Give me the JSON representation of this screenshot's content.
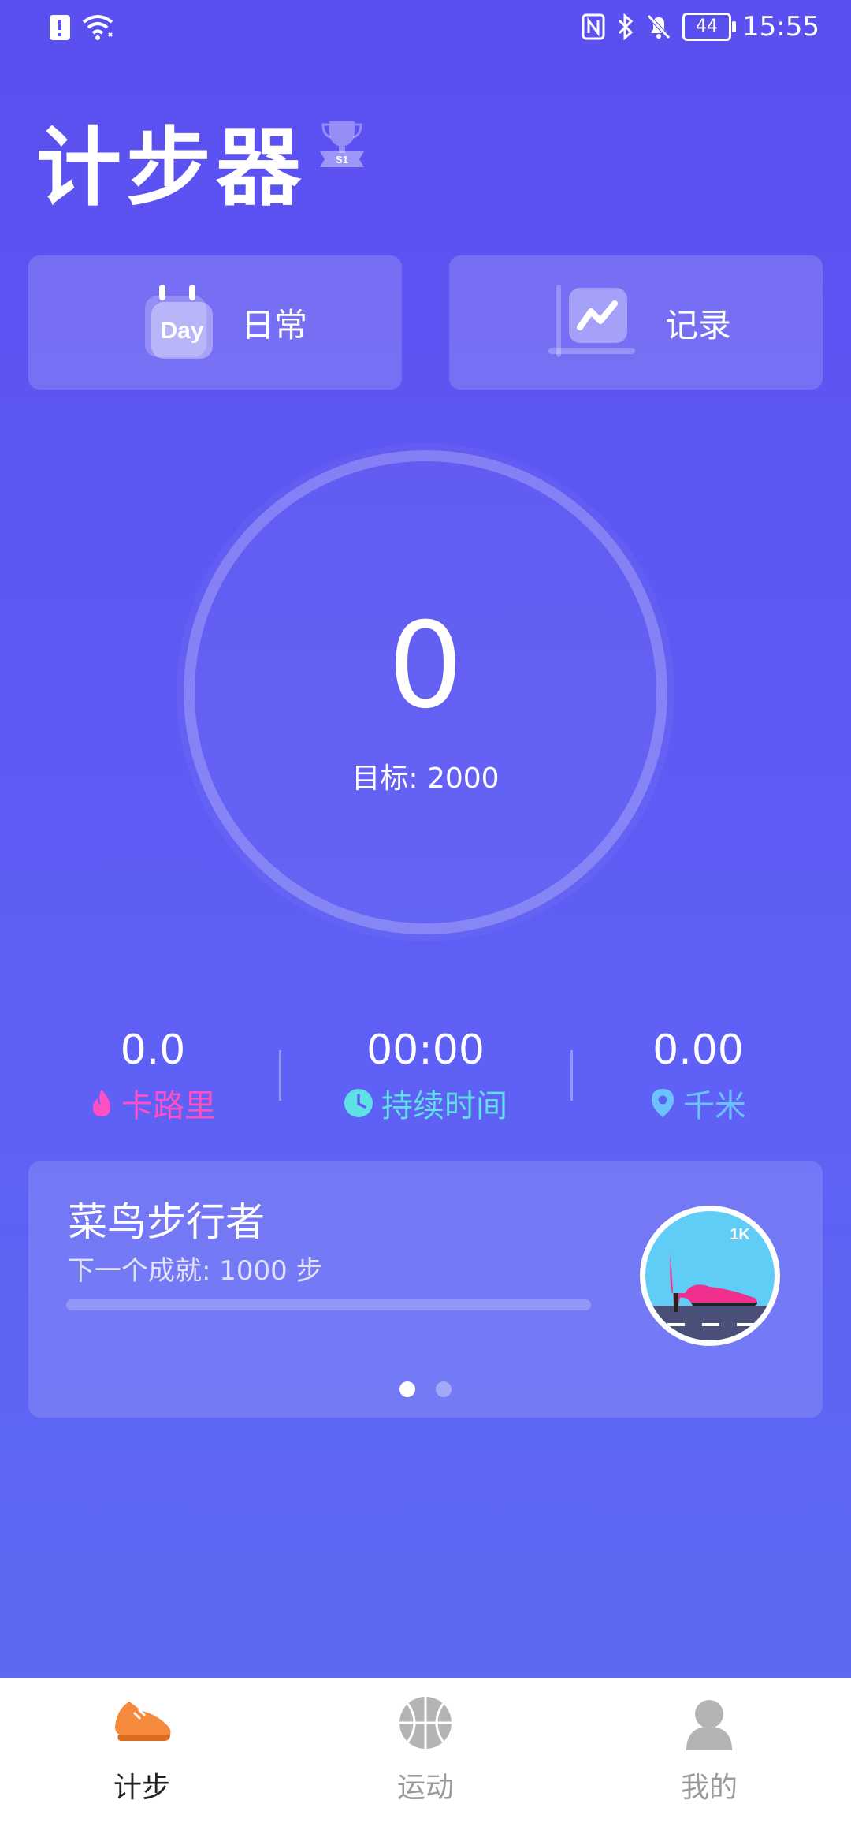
{
  "status_bar": {
    "time": "15:55",
    "battery": "44",
    "nfc_label": "N"
  },
  "header": {
    "title": "计步器",
    "badge_label": "S1"
  },
  "quick_actions": {
    "daily_label": "日常",
    "daily_icon_text": "Day",
    "record_label": "记录"
  },
  "progress_ring": {
    "steps": "0",
    "target": "目标: 2000",
    "progress_fraction": 0
  },
  "stats": {
    "calories_value": "0.0",
    "calories_label": "卡路里",
    "duration_value": "00:00",
    "duration_label": "持续时间",
    "distance_value": "0.00",
    "distance_label": "千米"
  },
  "achievement": {
    "title": "菜鸟步行者",
    "next": "下一个成就: 1000 步",
    "progress_fraction": 0,
    "badge_text": "1K",
    "pages": 2,
    "active_page": 0
  },
  "tabs": [
    {
      "label": "计步",
      "icon": "shoe-icon",
      "active": true
    },
    {
      "label": "运动",
      "icon": "basketball-icon",
      "active": false
    },
    {
      "label": "我的",
      "icon": "person-icon",
      "active": false
    }
  ],
  "colors": {
    "calories": "#ff4fc3",
    "duration": "#5fe0e6",
    "distance": "#6cc2ff",
    "tab_active_icon": "#f58a3c"
  }
}
